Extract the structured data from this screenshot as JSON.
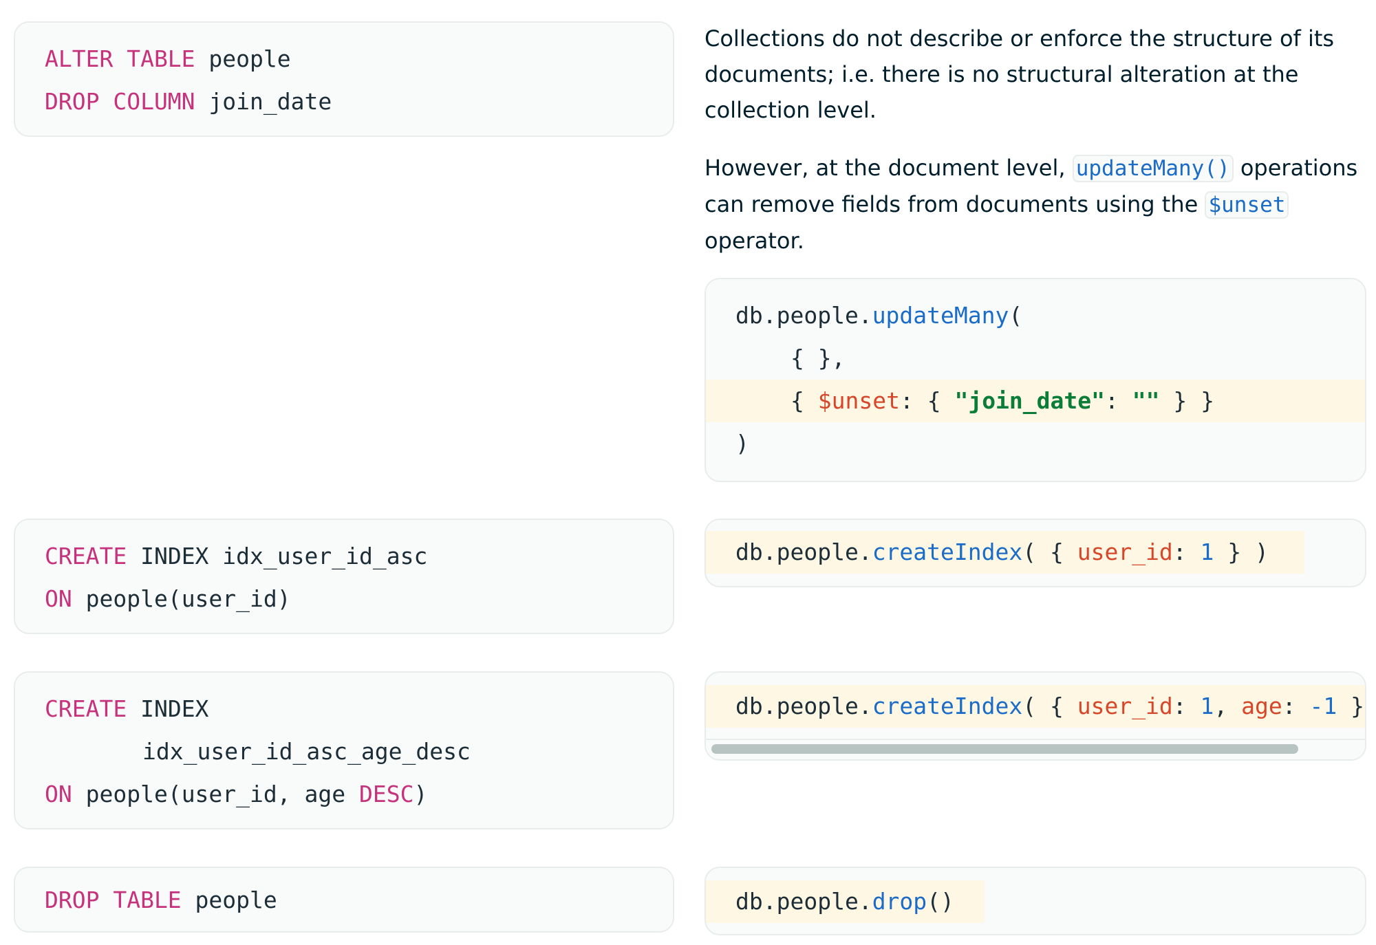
{
  "sql_blocks": [
    {
      "lines": [
        [
          {
            "t": "ALTER TABLE",
            "c": "kw"
          },
          {
            "t": " people"
          }
        ],
        [
          {
            "t": "DROP COLUMN",
            "c": "kw"
          },
          {
            "t": " join_date"
          }
        ]
      ]
    },
    {
      "lines": [
        [
          {
            "t": "CREATE",
            "c": "kw"
          },
          {
            "t": " INDEX idx_user_id_asc"
          }
        ],
        [
          {
            "t": "ON",
            "c": "kw"
          },
          {
            "t": " people(user_id)"
          }
        ]
      ]
    },
    {
      "lines": [
        [
          {
            "t": "CREATE",
            "c": "kw"
          },
          {
            "t": " INDEX"
          }
        ],
        [
          {
            "t": "idx_user_id_asc_age_desc"
          }
        ],
        [
          {
            "t": "ON",
            "c": "kw"
          },
          {
            "t": " people(user_id, age "
          },
          {
            "t": "DESC",
            "c": "kw"
          },
          {
            "t": ")"
          }
        ]
      ]
    },
    {
      "lines": [
        [
          {
            "t": "DROP TABLE",
            "c": "kw"
          },
          {
            "t": " people"
          }
        ]
      ]
    }
  ],
  "prose": {
    "p1": "Collections do not describe or enforce the structure of its documents; i.e. there is no structural alteration at the collection level.",
    "p2_before": "However, at the document level, ",
    "p2_code1": "updateMany()",
    "p2_middle": " operations can remove fields from documents using the ",
    "p2_code2": "$unset",
    "p2_after": " operator."
  },
  "mongo_blocks": [
    {
      "lines": [
        [
          {
            "t": "db.people."
          },
          {
            "t": "updateMany",
            "c": "fn"
          },
          {
            "t": "("
          }
        ],
        [
          {
            "t": "{ },"
          }
        ],
        [
          {
            "t": "{ "
          },
          {
            "t": "$unset",
            "c": "var"
          },
          {
            "t": ": { "
          },
          {
            "t": "\"join_date\"",
            "c": "str"
          },
          {
            "t": ": "
          },
          {
            "t": "\"\"",
            "c": "str"
          },
          {
            "t": " } }"
          }
        ],
        [
          {
            "t": ")"
          }
        ]
      ]
    },
    {
      "lines": [
        [
          {
            "t": "db.people."
          },
          {
            "t": "createIndex",
            "c": "fn"
          },
          {
            "t": "( { "
          },
          {
            "t": "user_id",
            "c": "var"
          },
          {
            "t": ": "
          },
          {
            "t": "1",
            "c": "num"
          },
          {
            "t": " } )"
          }
        ]
      ]
    },
    {
      "lines": [
        [
          {
            "t": "db.people."
          },
          {
            "t": "createIndex",
            "c": "fn"
          },
          {
            "t": "( { "
          },
          {
            "t": "user_id",
            "c": "var"
          },
          {
            "t": ": "
          },
          {
            "t": "1",
            "c": "num"
          },
          {
            "t": ", "
          },
          {
            "t": "age",
            "c": "var"
          },
          {
            "t": ": "
          },
          {
            "t": "-1",
            "c": "num"
          },
          {
            "t": " } )"
          }
        ]
      ]
    },
    {
      "lines": [
        [
          {
            "t": "db.people."
          },
          {
            "t": "drop",
            "c": "fn"
          },
          {
            "t": "()"
          }
        ]
      ]
    }
  ],
  "colors": {
    "keyword": "#c7327c",
    "function": "#1b6cc8",
    "field": "#d8462a",
    "string": "#0a7d39",
    "highlight": "#fef7e3",
    "block_bg": "#f9fbfa",
    "block_border": "#e8edeb"
  }
}
